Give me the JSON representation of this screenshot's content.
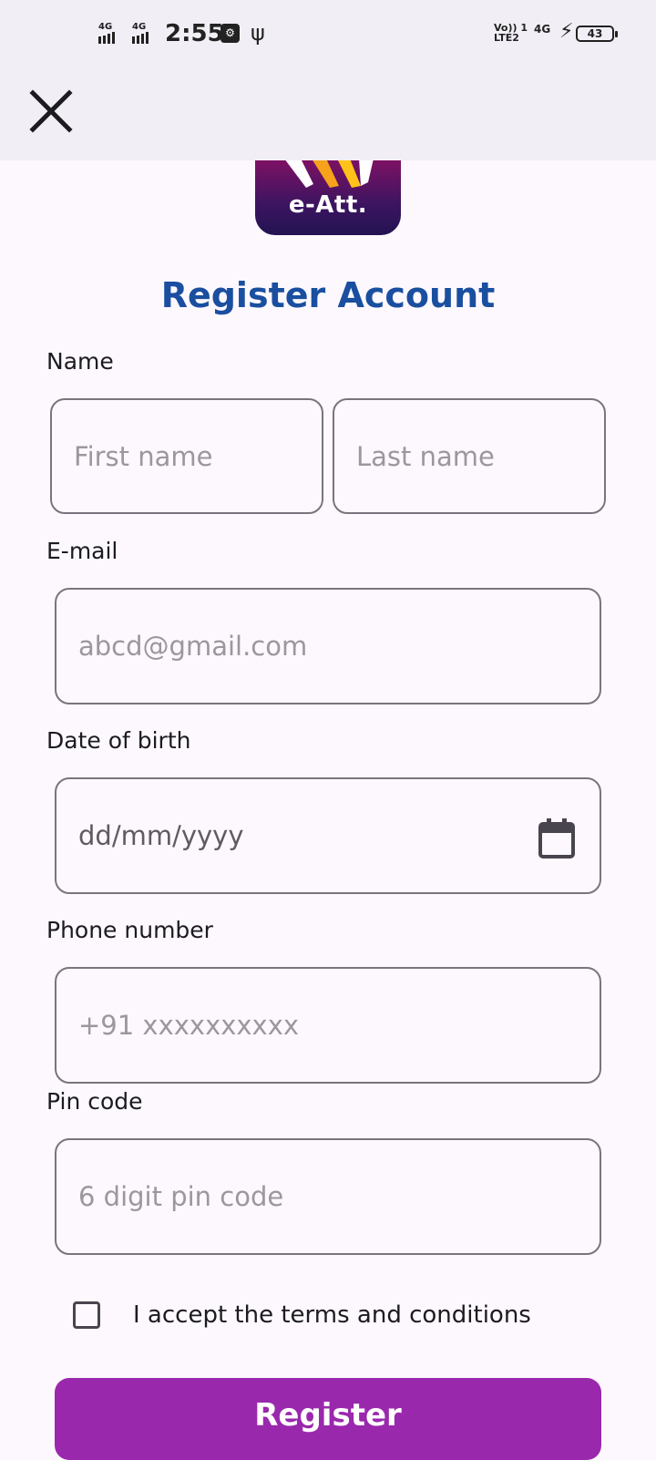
{
  "status_bar": {
    "sim1_type": "4G",
    "sim2_type": "4G",
    "time": "2:55",
    "volte_line1": "Vo)) 1",
    "volte_line2": "LTE2",
    "network_right": "4G",
    "battery_level": "43"
  },
  "app": {
    "logo_text": "e-Att.",
    "title": "Register Account"
  },
  "form": {
    "name_label": "Name",
    "first_name_placeholder": "First name",
    "last_name_placeholder": "Last name",
    "email_label": "E-mail",
    "email_placeholder": "abcd@gmail.com",
    "dob_label": "Date of birth",
    "dob_placeholder": "dd/mm/yyyy",
    "phone_label": "Phone number",
    "phone_placeholder": "+91 xxxxxxxxxx",
    "pin_label": "Pin code",
    "pin_placeholder": "6 digit pin code",
    "terms_text": "I accept the terms and conditions",
    "terms_checked": false,
    "register_label": "Register"
  },
  "colors": {
    "title": "#1a4fa0",
    "button": "#9a28ad",
    "status_bg": "#f1eff5"
  }
}
